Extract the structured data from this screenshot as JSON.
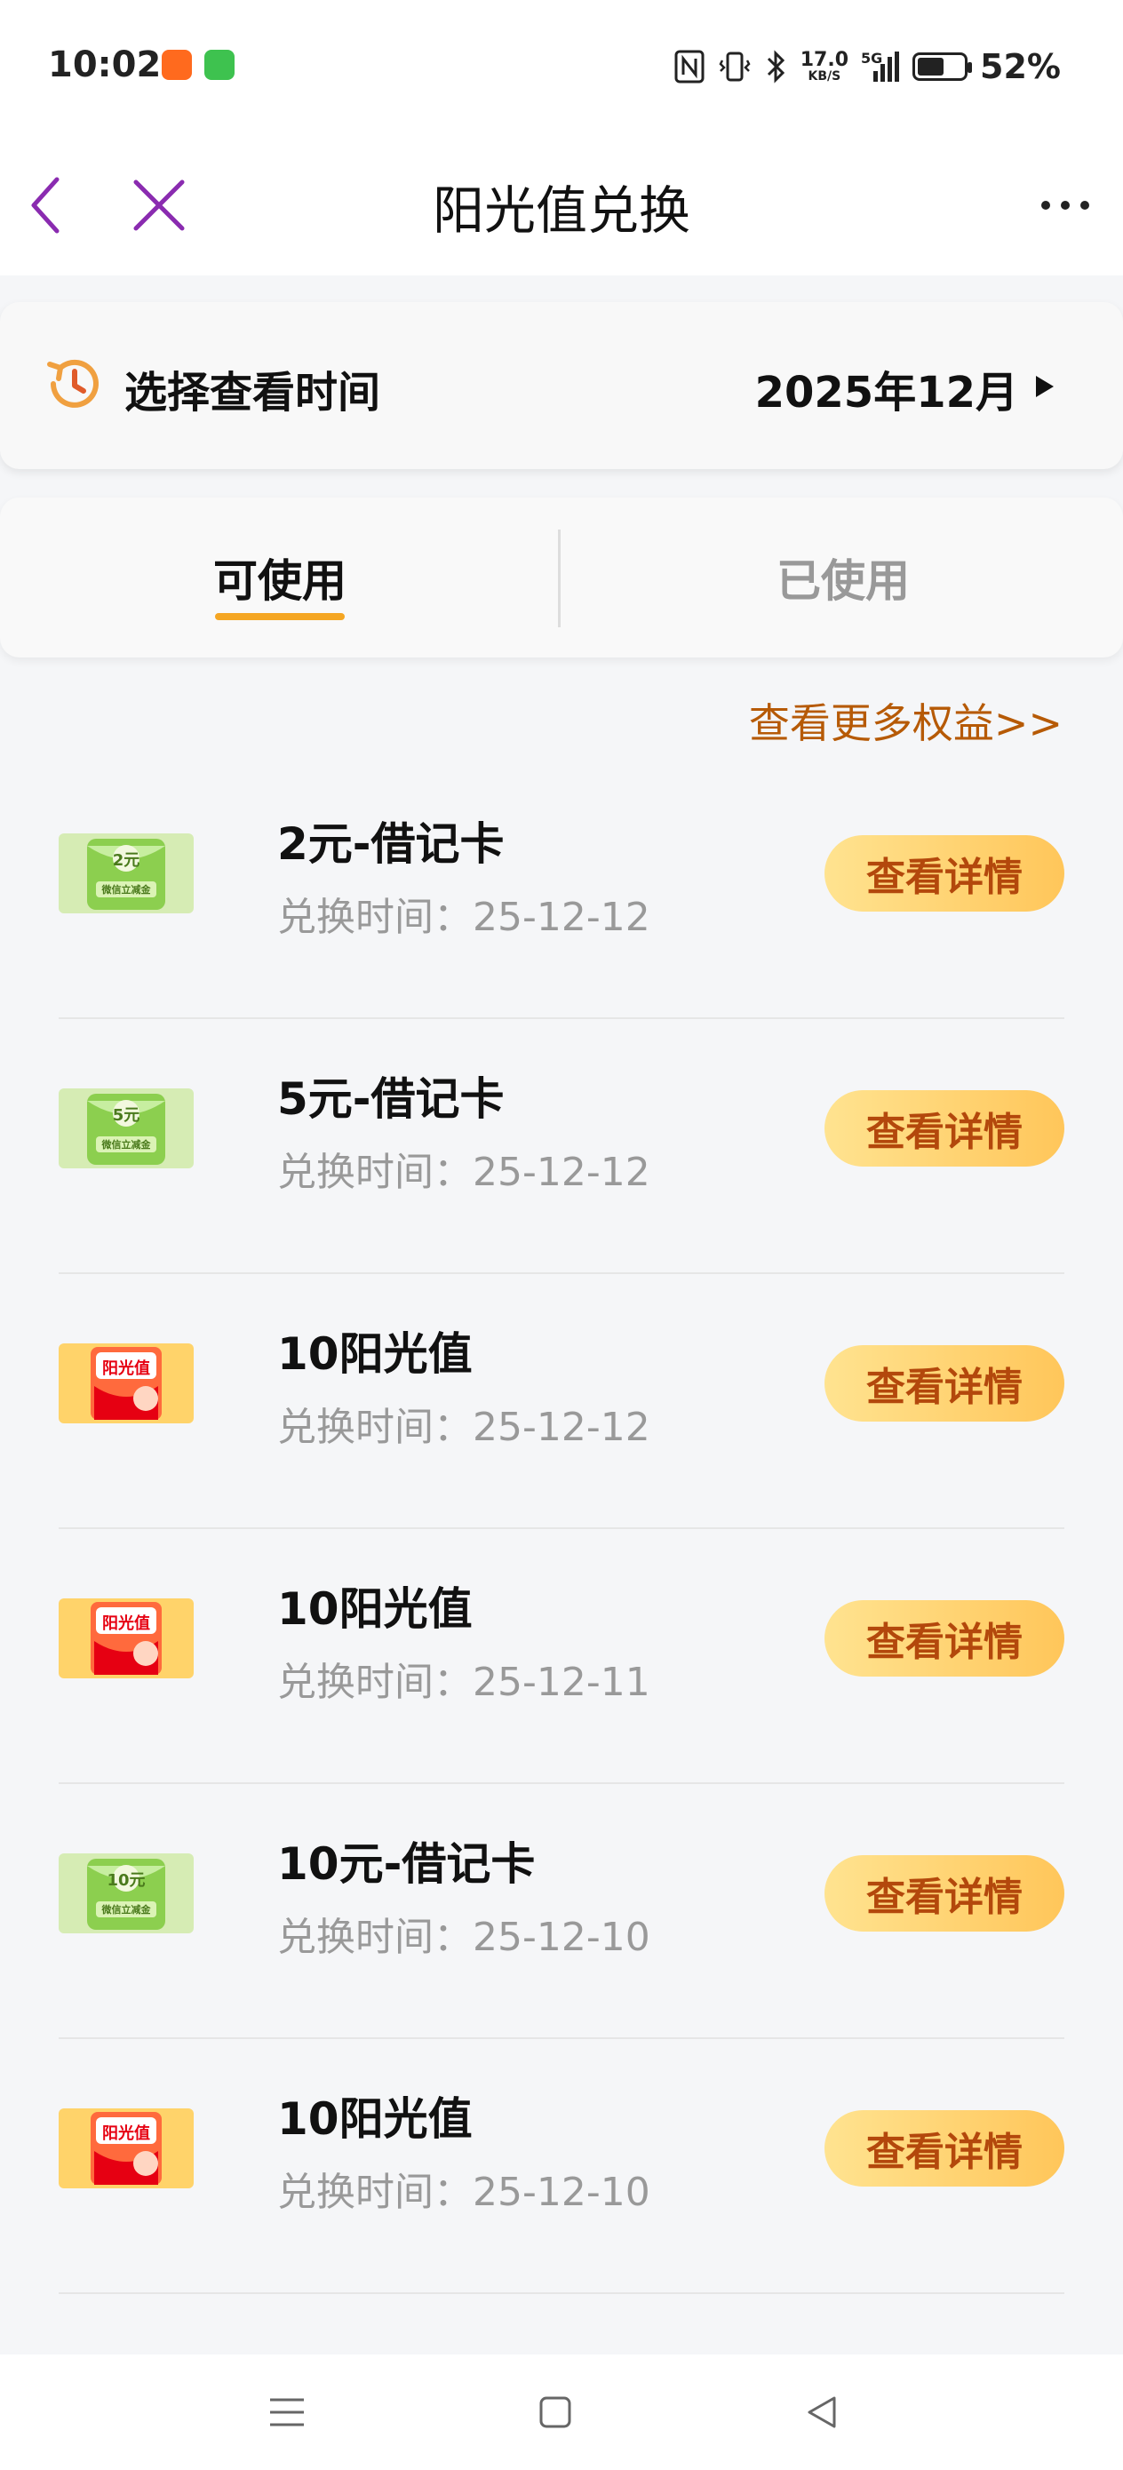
{
  "status_bar": {
    "time": "10:02",
    "network_speed": "17.0",
    "network_unit": "KB/S",
    "battery": "52%",
    "signal_label": "5G"
  },
  "title_bar": {
    "title": "阳光值兑换"
  },
  "time_selector": {
    "label": "选择查看时间",
    "value": "2025年12月"
  },
  "tabs": [
    {
      "label": "可使用",
      "active": true
    },
    {
      "label": "已使用",
      "active": false
    }
  ],
  "more_link": "查看更多权益>>",
  "items": [
    {
      "title": "2元-借记卡",
      "date": "兑换时间：25-12-12",
      "button": "查看详情",
      "thumb": "green",
      "thumb_text": "2元",
      "thumb_subtext": "微信立减金"
    },
    {
      "title": "5元-借记卡",
      "date": "兑换时间：25-12-12",
      "button": "查看详情",
      "thumb": "green",
      "thumb_text": "5元",
      "thumb_subtext": "微信立减金"
    },
    {
      "title": "10阳光值",
      "date": "兑换时间：25-12-12",
      "button": "查看详情",
      "thumb": "orange",
      "thumb_text": "阳光值"
    },
    {
      "title": "10阳光值",
      "date": "兑换时间：25-12-11",
      "button": "查看详情",
      "thumb": "orange",
      "thumb_text": "阳光值"
    },
    {
      "title": "10元-借记卡",
      "date": "兑换时间：25-12-10",
      "button": "查看详情",
      "thumb": "green",
      "thumb_text": "10元",
      "thumb_subtext": "微信立减金"
    },
    {
      "title": "10阳光值",
      "date": "兑换时间：25-12-10",
      "button": "查看详情",
      "thumb": "orange",
      "thumb_text": "阳光值"
    }
  ],
  "colors": {
    "accent_purple": "#8a2bb0",
    "tab_underline": "#f5a623",
    "link_brown": "#b65a06",
    "button_text": "#b3480c"
  }
}
